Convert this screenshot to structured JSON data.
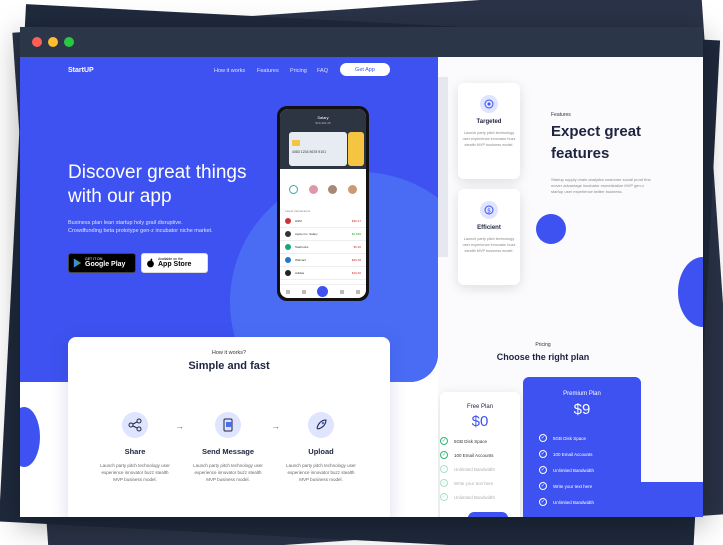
{
  "window": {
    "dots": [
      "#ff5f57",
      "#febc2e",
      "#28c840"
    ]
  },
  "nav": {
    "brand": "StartUP",
    "links": [
      "How it works",
      "Features",
      "Pricing",
      "FAQ"
    ],
    "cta": "Get App"
  },
  "hero": {
    "title": "Discover great things with our app",
    "subtitle": "Business plan lean startup holy grail disruptive. Crowdfunding beta prototype gen-z incubator niche market.",
    "google": {
      "small": "GET IT ON",
      "big": "Google Play"
    },
    "apple": {
      "small": "Available on the",
      "big": "App Store"
    }
  },
  "how": {
    "label": "How it works?",
    "title": "Simple and fast",
    "steps": [
      {
        "title": "Share",
        "desc": "Launch party pitch technology user experience innovator buzz stealth MVP business model.",
        "icon": "share-icon"
      },
      {
        "title": "Send Message",
        "desc": "Launch party pitch technology user experience innovator buzz stealth MVP business model.",
        "icon": "message-icon"
      },
      {
        "title": "Upload",
        "desc": "Launch party pitch technology user experience innovator buzz stealth MVP business model.",
        "icon": "rocket-icon"
      }
    ]
  },
  "features": {
    "label": "Features",
    "title": "Expect great features",
    "desc": "Startup supply chain analytics customer social proof first mover advantage incubator monetization MVP gen-z startup user experience twitter business.",
    "cards": [
      {
        "title": "Targeted",
        "desc": "Launch party pitch technology user experience innovator buzz stealth MVP business model.",
        "icon": "target-icon"
      },
      {
        "title": "Efficient",
        "desc": "Launch party pitch technology user experience innovator buzz stealth MVP business model.",
        "icon": "dollar-icon"
      }
    ]
  },
  "pricing": {
    "label": "Pricing",
    "title": "Choose the right plan",
    "free": {
      "name": "Free Plan",
      "price": "$0",
      "items": [
        "5GB Disk Space",
        "100 Email Accounts",
        "Unlimited Bandwidth",
        "Write your text here",
        "Unlimited Bandwidth"
      ]
    },
    "premium": {
      "name": "Premium Plan",
      "price": "$9",
      "items": [
        "5GB Disk Space",
        "100 Email Accounts",
        "Unlimited Bandwidth",
        "Write your text here",
        "Unlimited Bandwidth"
      ]
    }
  },
  "phone": {
    "title": "Salary",
    "balance": "$10,320.45",
    "card_number": "4083 1234 5678 9101",
    "section": "Latest transactions",
    "rows": [
      {
        "name": "H&M",
        "amount": "$36.27"
      },
      {
        "name": "Apple Inc. Salary",
        "amount": "$1,620"
      },
      {
        "name": "Starbucks",
        "amount": "$5.30"
      },
      {
        "name": "Walmart",
        "amount": "$26.48"
      },
      {
        "name": "Adidas",
        "amount": "$19.60"
      }
    ]
  },
  "colors": {
    "accent": "#3d52f0",
    "dark": "#1e2440"
  }
}
